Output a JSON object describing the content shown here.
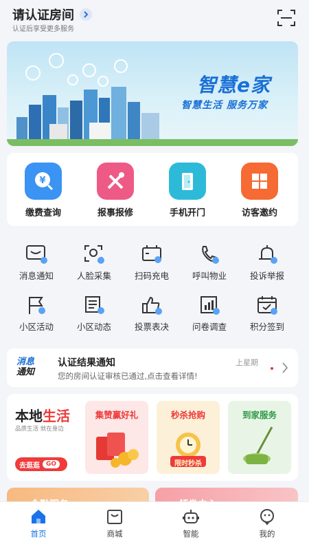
{
  "header": {
    "title": "请认证房间",
    "subtitle": "认证后享受更多服务"
  },
  "banner": {
    "title": "智慧e家",
    "subtitle": "智慧生活 服务万家"
  },
  "quick_actions": [
    {
      "label": "缴费查询",
      "icon": "payment-query-icon",
      "color": "#2f8bf0"
    },
    {
      "label": "报事报修",
      "icon": "repair-tools-icon",
      "color": "#ef4e7a"
    },
    {
      "label": "手机开门",
      "icon": "door-open-icon",
      "color": "#26b8d8"
    },
    {
      "label": "访客邀约",
      "icon": "visitor-grid-icon",
      "color": "#f5662f"
    }
  ],
  "services_row1": [
    {
      "label": "消息通知",
      "icon": "message-icon"
    },
    {
      "label": "人脸采集",
      "icon": "face-scan-icon"
    },
    {
      "label": "扫码充电",
      "icon": "battery-icon"
    },
    {
      "label": "呼叫物业",
      "icon": "phone-call-icon"
    },
    {
      "label": "投诉举报",
      "icon": "bell-icon"
    }
  ],
  "services_row2": [
    {
      "label": "小区活动",
      "icon": "flag-icon"
    },
    {
      "label": "小区动态",
      "icon": "news-icon"
    },
    {
      "label": "投票表决",
      "icon": "thumbs-up-icon"
    },
    {
      "label": "问卷调查",
      "icon": "chart-doc-icon"
    },
    {
      "label": "积分签到",
      "icon": "calendar-check-icon"
    }
  ],
  "notice": {
    "logo_line1": "消息",
    "logo_line2": "通知",
    "title": "认证结果通知",
    "text": "您的房间认证审核已通过,点击查看详情!",
    "time": "上星期"
  },
  "local_life": {
    "title_part1": "本地",
    "title_part2": "生活",
    "subtitle": "品质生活 就在身边",
    "button_label": "去逛逛",
    "button_go": "GO",
    "tiles": [
      {
        "label": "集赞赢好礼",
        "color": "#ee3a3a"
      },
      {
        "label": "秒杀抢购",
        "color": "#ee3a3a"
      },
      {
        "label": "到家服务",
        "color": "#2f9a47"
      }
    ],
    "tile_badge": "限时秒杀"
  },
  "bottom_cards": [
    {
      "label": "金融服务"
    },
    {
      "label": "领券中心"
    }
  ],
  "tabbar": [
    {
      "label": "首页",
      "icon": "home-icon",
      "active": true
    },
    {
      "label": "商城",
      "icon": "shop-icon",
      "active": false
    },
    {
      "label": "智能",
      "icon": "robot-icon",
      "active": false
    },
    {
      "label": "我的",
      "icon": "profile-icon",
      "active": false
    }
  ],
  "colors": {
    "accent": "#1a73e8",
    "red": "#ee3a3a",
    "background": "#f3f5f9"
  }
}
